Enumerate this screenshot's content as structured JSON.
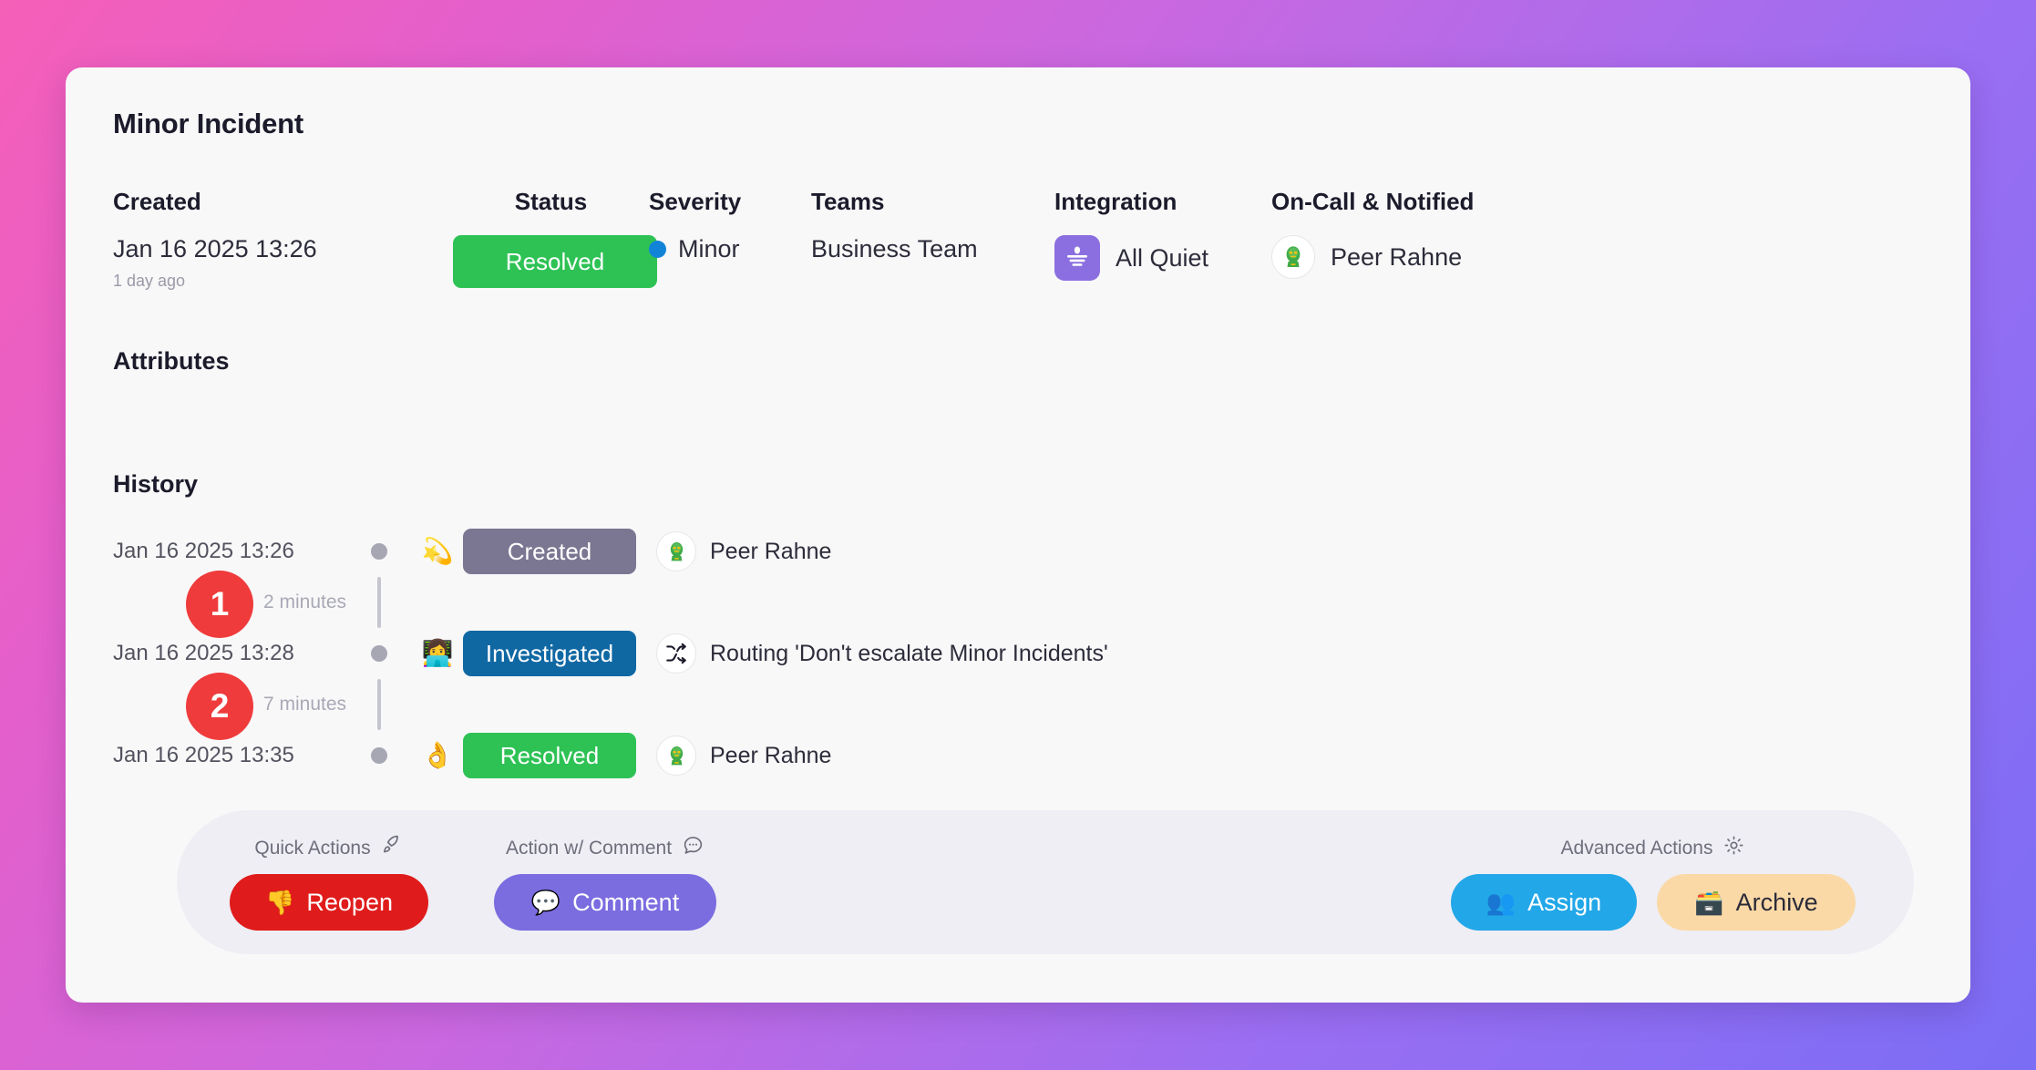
{
  "incident": {
    "title": "Minor Incident"
  },
  "summary": {
    "created": {
      "label": "Created",
      "value": "Jan 16 2025 13:26",
      "relative": "1 day ago"
    },
    "status": {
      "label": "Status",
      "value": "Resolved",
      "color": "#2ec255"
    },
    "severity": {
      "label": "Severity",
      "value": "Minor",
      "color": "#1184d8"
    },
    "teams": {
      "label": "Teams",
      "value": "Business Team"
    },
    "integration": {
      "label": "Integration",
      "value": "All Quiet",
      "logo_color": "#8b6fe0",
      "icon": "allquiet-logo-icon"
    },
    "oncall": {
      "label": "On-Call & Notified",
      "value": "Peer Rahne",
      "avatar_icon": "alien-avatar-icon"
    }
  },
  "attributes": {
    "heading": "Attributes"
  },
  "history": {
    "heading": "History",
    "events": [
      {
        "time": "Jan 16 2025 13:26",
        "emoji": "💫",
        "emoji_name": "comet-icon",
        "badge": "Created",
        "badge_color": "#7b7691",
        "actor": "Peer Rahne",
        "actor_icon": "alien-avatar-icon"
      },
      {
        "time": "Jan 16 2025 13:28",
        "emoji": "👩‍💻",
        "emoji_name": "person-with-laptop-icon",
        "badge": "Investigated",
        "badge_color": "#1068a3",
        "actor": "Routing 'Don't escalate Minor Incidents'",
        "actor_icon": "shuffle-icon"
      },
      {
        "time": "Jan 16 2025 13:35",
        "emoji": "👌",
        "emoji_name": "ok-hand-icon",
        "badge": "Resolved",
        "badge_color": "#2ec255",
        "actor": "Peer Rahne",
        "actor_icon": "alien-avatar-icon"
      }
    ],
    "gaps": [
      {
        "label": "2 minutes",
        "annotation": "1"
      },
      {
        "label": "7 minutes",
        "annotation": "2"
      }
    ]
  },
  "actionbar": {
    "quick_actions": {
      "label": "Quick Actions",
      "icon": "rocket-icon",
      "buttons": [
        {
          "label": "Reopen",
          "emoji": "👎",
          "emoji_name": "thumbs-down-icon",
          "color": "#e01b1b"
        }
      ]
    },
    "action_with_comment": {
      "label": "Action w/ Comment",
      "icon": "speech-bubble-icon",
      "buttons": [
        {
          "label": "Comment",
          "emoji": "💬",
          "emoji_name": "speech-balloon-icon",
          "color": "#7b6ce0"
        }
      ]
    },
    "advanced_actions": {
      "label": "Advanced Actions",
      "icon": "gear-icon",
      "buttons": [
        {
          "label": "Assign",
          "emoji": "👥",
          "emoji_name": "busts-in-silhouette-icon",
          "color": "#22a7e8"
        },
        {
          "label": "Archive",
          "emoji": "🗃️",
          "emoji_name": "card-file-box-icon",
          "color": "#fbd9a7"
        }
      ]
    }
  }
}
